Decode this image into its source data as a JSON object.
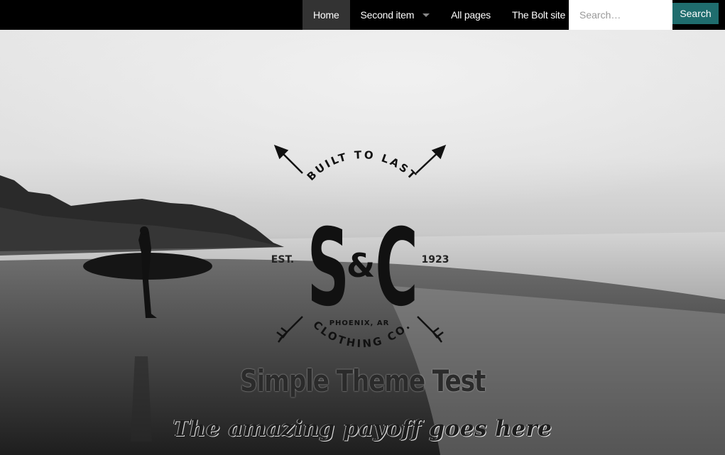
{
  "nav": {
    "items": [
      {
        "label": "Home",
        "active": true
      },
      {
        "label": "Second item",
        "has_dropdown": true
      },
      {
        "label": "All pages"
      },
      {
        "label": "The Bolt site"
      }
    ],
    "search_placeholder": "Search…",
    "search_button": "Search"
  },
  "hero": {
    "logo": {
      "top_text": "BUILT TO LAST",
      "monogram_left": "S",
      "monogram_amp": "&",
      "monogram_right": "C",
      "est_label": "EST.",
      "year": "1923",
      "location": "PHOENIX, AR",
      "bottom_text": "CLOTHING CO."
    },
    "title": "Simple Theme Test",
    "subtitle": "The amazing payoff goes here"
  },
  "colors": {
    "nav_bg": "#000000",
    "nav_active_bg": "#333333",
    "search_button_bg": "#1f6d6e"
  }
}
